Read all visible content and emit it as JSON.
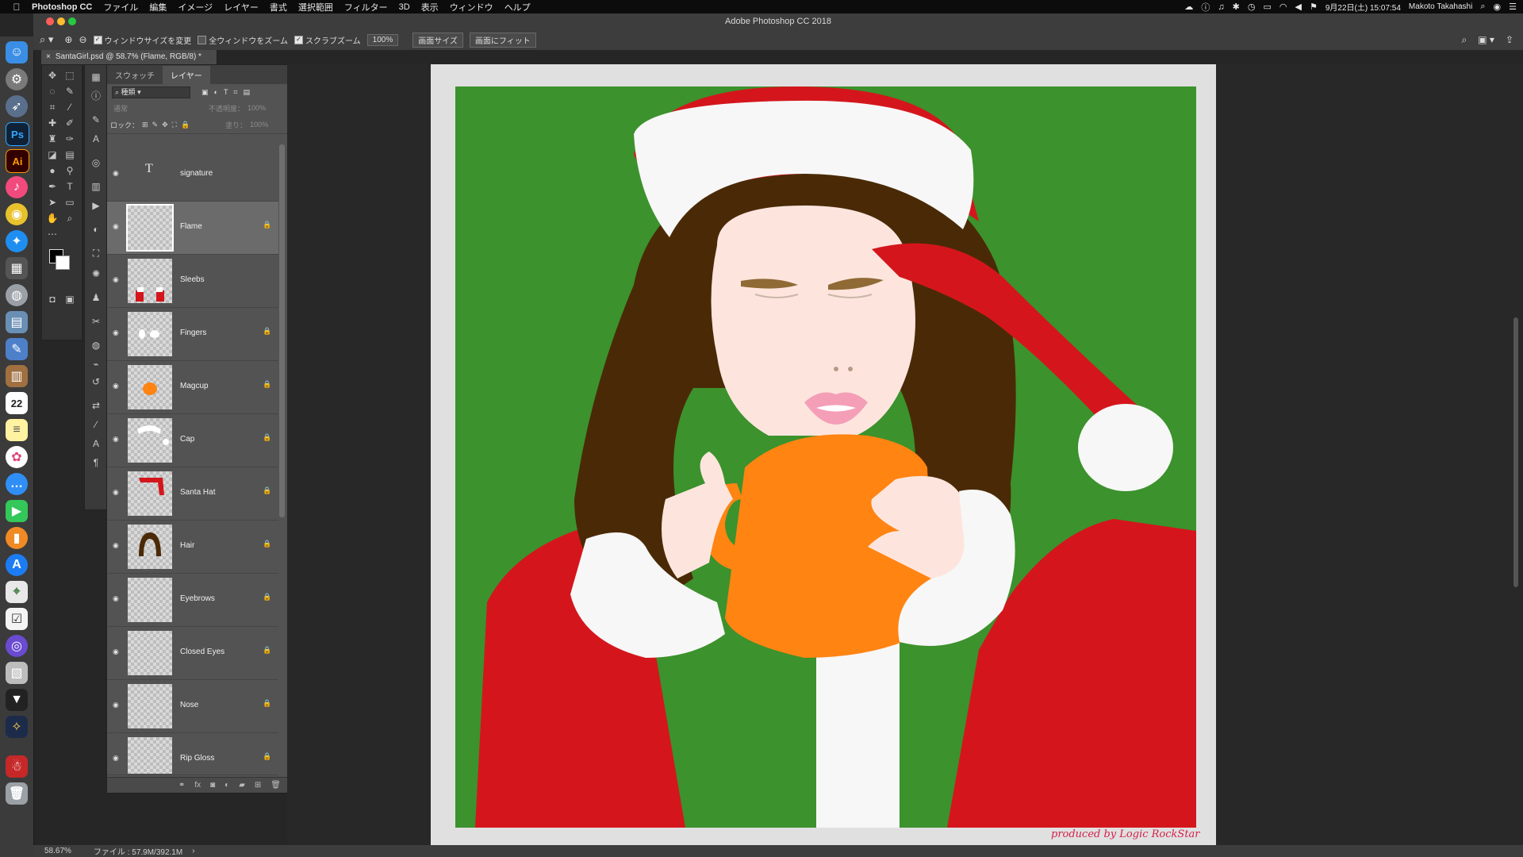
{
  "menubar": {
    "app_name": "Photoshop CC",
    "items": [
      "ファイル",
      "編集",
      "イメージ",
      "レイヤー",
      "書式",
      "選択範囲",
      "フィルター",
      "3D",
      "表示",
      "ウィンドウ",
      "ヘルプ"
    ],
    "datetime": "9月22日(土) 15:07:54",
    "user": "Makoto Takahashi"
  },
  "window": {
    "title": "Adobe Photoshop CC 2018"
  },
  "options_bar": {
    "resize_windows": "ウィンドウサイズを変更",
    "zoom_all": "全ウィンドウをズーム",
    "scrubby_zoom": "スクラブズーム",
    "zoom_value": "100%",
    "fit_screen": "画面サイズ",
    "fill_screen": "画面にフィット"
  },
  "document": {
    "tab_label": "SantaGirl.psd @ 58.7% (Flame, RGB/8) *"
  },
  "layers_panel": {
    "tab_swatches": "スウォッチ",
    "tab_layers": "レイヤー",
    "filter_kind": "種類",
    "blend_mode": "通常",
    "opacity_label": "不透明度：",
    "opacity_value": "100%",
    "lock_label": "ロック：",
    "fill_label": "塗り：",
    "fill_value": "100%",
    "layers": [
      {
        "name": "signature",
        "type": "text",
        "locked": false,
        "selected": false
      },
      {
        "name": "Flame",
        "type": "image",
        "locked": true,
        "selected": true
      },
      {
        "name": "Sleebs",
        "type": "image",
        "locked": false,
        "selected": false
      },
      {
        "name": "Fingers",
        "type": "image",
        "locked": true,
        "selected": false
      },
      {
        "name": "Magcup",
        "type": "image",
        "locked": true,
        "selected": false
      },
      {
        "name": "Cap",
        "type": "image",
        "locked": true,
        "selected": false
      },
      {
        "name": "Santa Hat",
        "type": "image",
        "locked": true,
        "selected": false
      },
      {
        "name": "Hair",
        "type": "image",
        "locked": true,
        "selected": false
      },
      {
        "name": "Eyebrows",
        "type": "image",
        "locked": true,
        "selected": false
      },
      {
        "name": "Closed Eyes",
        "type": "image",
        "locked": true,
        "selected": false
      },
      {
        "name": "Nose",
        "type": "image",
        "locked": true,
        "selected": false
      },
      {
        "name": "Rip Gloss",
        "type": "image",
        "locked": true,
        "selected": false
      }
    ]
  },
  "artwork": {
    "credit": "produced by Logic RockStar",
    "colors": {
      "background": "#3c922c",
      "frame": "#e0e0e0",
      "red": "#d4161c",
      "white": "#f7f7f7",
      "hair": "#4a2a06",
      "skin": "#fde5de",
      "mug": "#ff8412",
      "lips": "#f59eb7",
      "brows": "#8f6a35"
    }
  },
  "status_bar": {
    "zoom": "58.67%",
    "file_info": "ファイル : 57.9M/392.1M"
  }
}
